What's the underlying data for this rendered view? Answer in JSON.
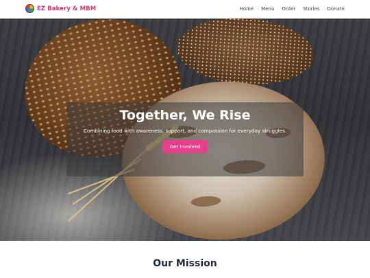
{
  "brand": {
    "name": "EZ Bakery & MBM",
    "logo_icon": "globe-logo-icon"
  },
  "nav": {
    "links": [
      "Home",
      "Menu",
      "Order",
      "Stories",
      "Donate"
    ]
  },
  "hero": {
    "title": "Together, We Rise",
    "subtitle": "Combining food with awareness, support, and compassion for everyday struggles.",
    "cta_label": "Get Involved",
    "image": "bread-loaves-on-wooden-table"
  },
  "mission": {
    "heading": "Our Mission"
  },
  "colors": {
    "brand": "#d6336c",
    "cta": "#e83e8c",
    "heading": "#222a36"
  }
}
